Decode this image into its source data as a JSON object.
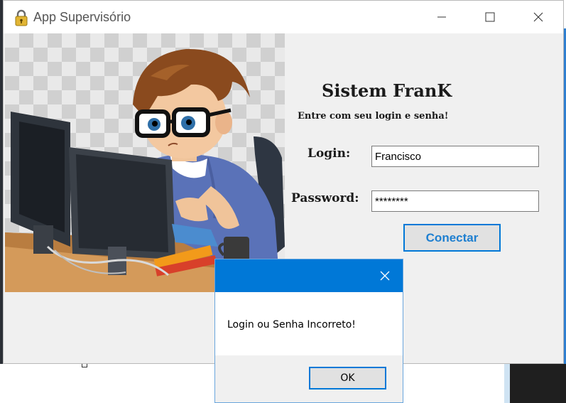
{
  "window": {
    "title": "App Supervisório",
    "icon": "lock-icon"
  },
  "titlebar_controls": [
    "minimize-icon",
    "maximize-icon",
    "close-icon"
  ],
  "form": {
    "title": "Sistem FranK",
    "subtitle": "Entre com seu login e senha!",
    "login_label": "Login:",
    "login_value": "Francisco",
    "password_label": "Password:",
    "password_value": "********",
    "connect_label": "Conectar"
  },
  "illustration": "cartoon boy using computer",
  "message_box": {
    "text": "Login ou Senha Incorreto!",
    "ok_label": "OK",
    "close_icon": "close-icon"
  },
  "colors": {
    "accent": "#0078d7",
    "window_bg": "#f0f0f0",
    "button_text": "#1e7fd0"
  }
}
